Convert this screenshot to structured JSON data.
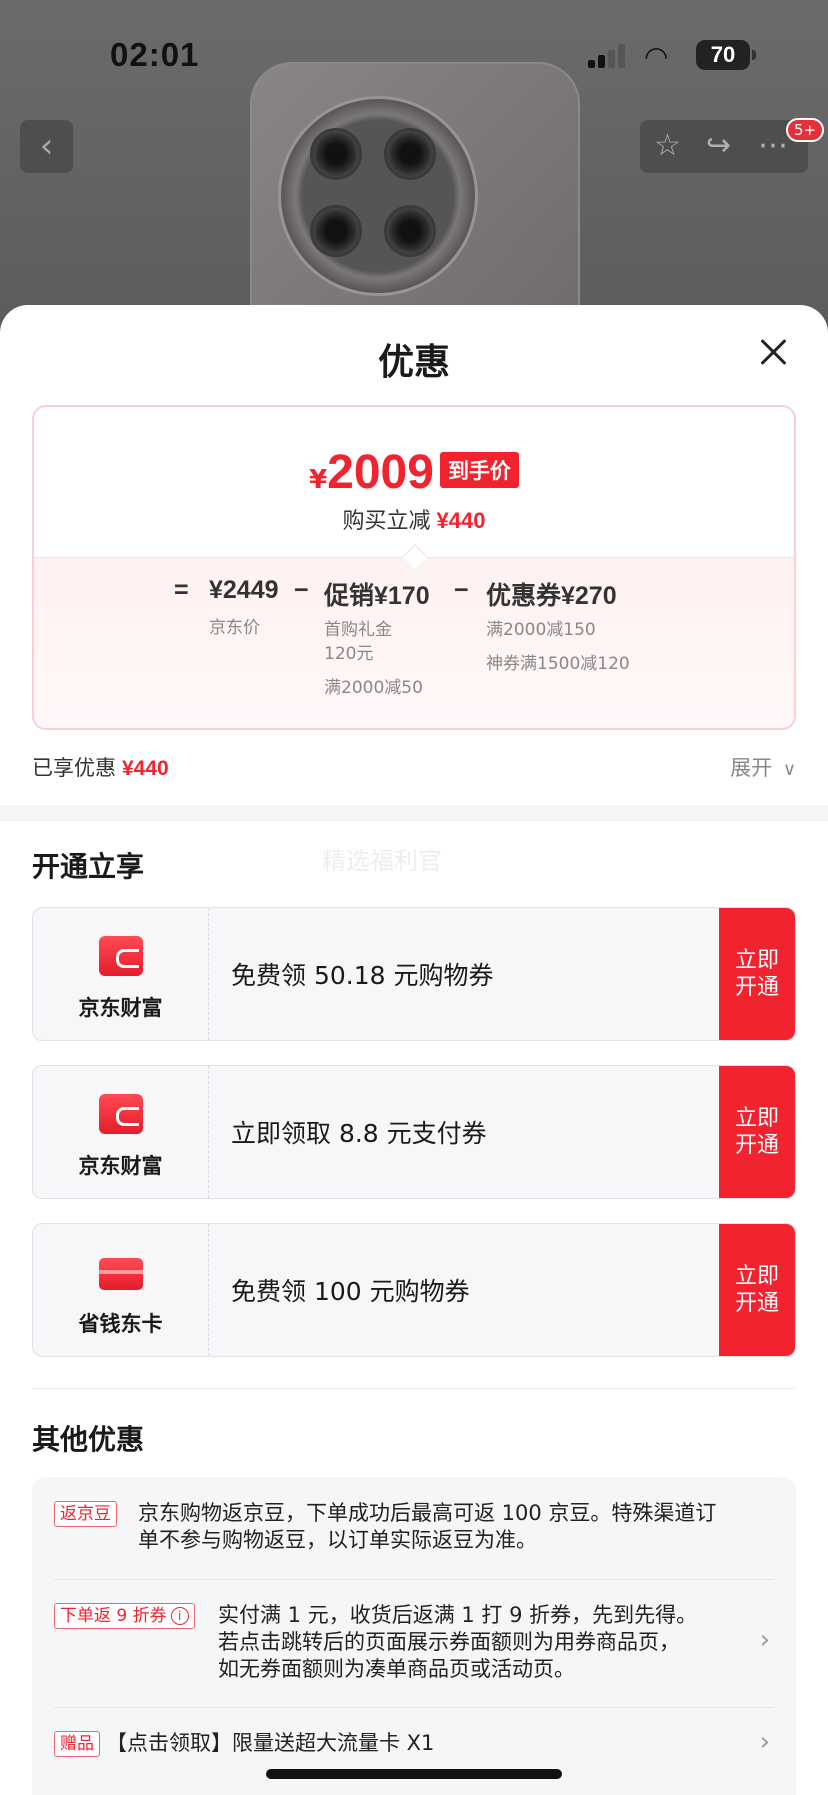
{
  "status_bar": {
    "time": "02:01",
    "battery": "70"
  },
  "nav": {
    "back_icon": "chevron-left-icon",
    "cart_badge": "5+"
  },
  "sheet": {
    "title": "优惠",
    "price": {
      "currency": "¥",
      "final": "2009",
      "final_tag": "到手价",
      "save_label": "购买立减",
      "save_amount": "¥440",
      "eq": "=",
      "jd_price": "¥2449",
      "jd_price_label": "京东价",
      "minus": "−",
      "promo_label": "促销¥170",
      "promo_sub1a": "首购礼金",
      "promo_sub1b": "120元",
      "promo_sub2": "满2000减50",
      "coupon_label": "优惠券¥270",
      "coupon_sub1": "满2000减150",
      "coupon_sub2": "神券满1500减120"
    },
    "enjoyed_label": "已享优惠",
    "enjoyed_amount": "¥440",
    "expand_label": "展开",
    "open_section_title": "开通立享",
    "watermark": "精选福利官",
    "offers": [
      {
        "brand": "京东财富",
        "desc": "免费领 50.18 元购物券",
        "cta_line1": "立即",
        "cta_line2": "开通"
      },
      {
        "brand": "京东财富",
        "desc": "立即领取 8.8 元支付券",
        "cta_line1": "立即",
        "cta_line2": "开通"
      },
      {
        "brand": "省钱东卡",
        "desc": "免费领 100 元购物券",
        "cta_line1": "立即",
        "cta_line2": "开通"
      }
    ],
    "other_section_title": "其他优惠",
    "promos": [
      {
        "tag": "返京豆",
        "line1": "京东购物返京豆，下单成功后最高可返 100 京豆。特殊渠道订",
        "line2": "单不参与购物返豆，以订单实际返豆为准。"
      },
      {
        "tag": "下单返 9 折券",
        "line1": "实付满 1 元，收货后返满 1 打 9 折券，先到先得。",
        "line2": "若点击跳转后的页面展示券面额则为用券商品页，",
        "line3": "如无券面额则为凑单商品页或活动页。"
      },
      {
        "tag": "赠品",
        "line1": "【点击领取】限量送超大流量卡 X1"
      }
    ]
  },
  "colors": {
    "accent": "#f0232e",
    "sheet_bg": "#ffffff",
    "box_bg": "#f5f6f8"
  }
}
